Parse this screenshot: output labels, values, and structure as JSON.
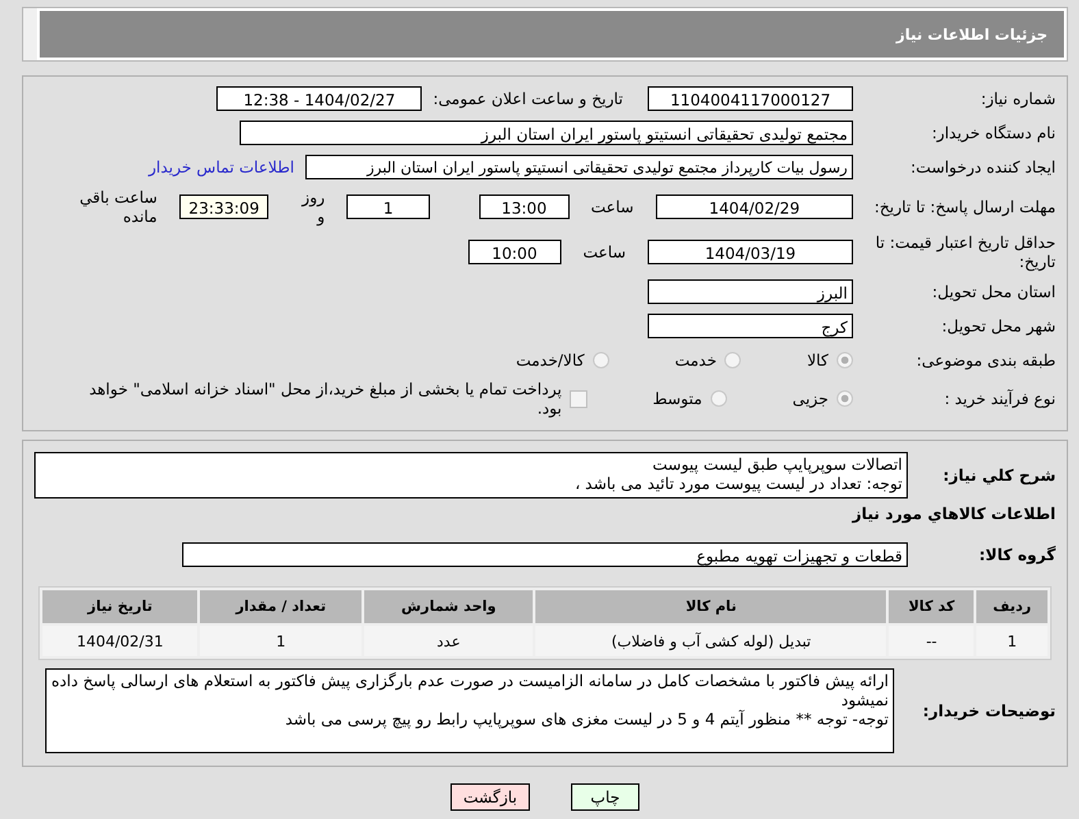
{
  "header": {
    "title": "جزئیات اطلاعات نیاز"
  },
  "form": {
    "need_number": {
      "label": "شماره نیاز:",
      "value": "1104004117000127"
    },
    "announce": {
      "label": "تاریخ و ساعت اعلان عمومی:",
      "value": "1404/02/27 - 12:38"
    },
    "buyer": {
      "label": "نام دستگاه خریدار:",
      "value": "مجتمع تولیدی تحقیقاتی انستیتو پاستور ایران استان البرز"
    },
    "creator": {
      "label": "ایجاد کننده درخواست:",
      "value": "رسول بیات کارپرداز مجتمع تولیدی تحقیقاتی انستیتو پاستور ایران استان البرز",
      "link": "اطلاعات تماس خریدار"
    },
    "deadline": {
      "label": "مهلت ارسال پاسخ: تا تاریخ:",
      "date": "1404/02/29",
      "time_label": "ساعت",
      "time": "13:00",
      "days": "1",
      "days_label": "روز و",
      "remaining": "23:33:09",
      "remaining_label": "ساعت باقي مانده"
    },
    "validity": {
      "label": "حداقل تاریخ اعتبار قیمت: تا تاریخ:",
      "date": "1404/03/19",
      "time_label": "ساعت",
      "time": "10:00"
    },
    "province": {
      "label": "استان محل تحویل:",
      "value": "البرز"
    },
    "city": {
      "label": "شهر محل تحویل:",
      "value": "کرج"
    },
    "category": {
      "label": "طبقه بندی موضوعی:",
      "options": [
        {
          "label": "کالا",
          "selected": true
        },
        {
          "label": "خدمت",
          "selected": false
        },
        {
          "label": "کالا/خدمت",
          "selected": false
        }
      ]
    },
    "process": {
      "label": "نوع فرآیند خرید :",
      "options": [
        {
          "label": "جزیی",
          "selected": true
        },
        {
          "label": "متوسط",
          "selected": false
        }
      ],
      "payment": {
        "label": "پرداخت تمام یا بخشی از مبلغ خرید،از محل \"اسناد خزانه اسلامی\" خواهد بود.",
        "checked": false
      }
    }
  },
  "details": {
    "summary": {
      "label": "شرح کلي نیاز:",
      "lines": [
        "اتصالات سوپرپایپ طبق لیست پیوست",
        "توجه: تعداد در لیست پیوست مورد تائید می باشد ،"
      ]
    },
    "goods_heading": "اطلاعات کالاهاي مورد نیاز",
    "group": {
      "label": "گروه کالا:",
      "value": "قطعات و تجهیزات تهویه مطبوع"
    },
    "table": {
      "columns": [
        "ردیف",
        "کد کالا",
        "نام کالا",
        "واحد شمارش",
        "تعداد / مقدار",
        "تاریخ نیاز"
      ],
      "rows": [
        [
          "1",
          "--",
          "تبدیل (لوله کشی آب و فاضلاب)",
          "عدد",
          "1",
          "1404/02/31"
        ]
      ]
    },
    "notes": {
      "label": "توضیحات خریدار:",
      "lines": [
        "ارائه پیش فاکتور با مشخصات کامل در سامانه الزامیست در صورت عدم بارگزاری پیش فاکتور به استعلام های ارسالی پاسخ داده نمیشود",
        "توجه- توجه ** منظور آیتم 4 و 5 در لیست مغزی های سوپرپایپ رابط رو پیچ پرسی می باشد"
      ]
    }
  },
  "buttons": [
    {
      "label": "چاپ",
      "kind": "print"
    },
    {
      "label": "بازگشت",
      "kind": "back"
    }
  ]
}
